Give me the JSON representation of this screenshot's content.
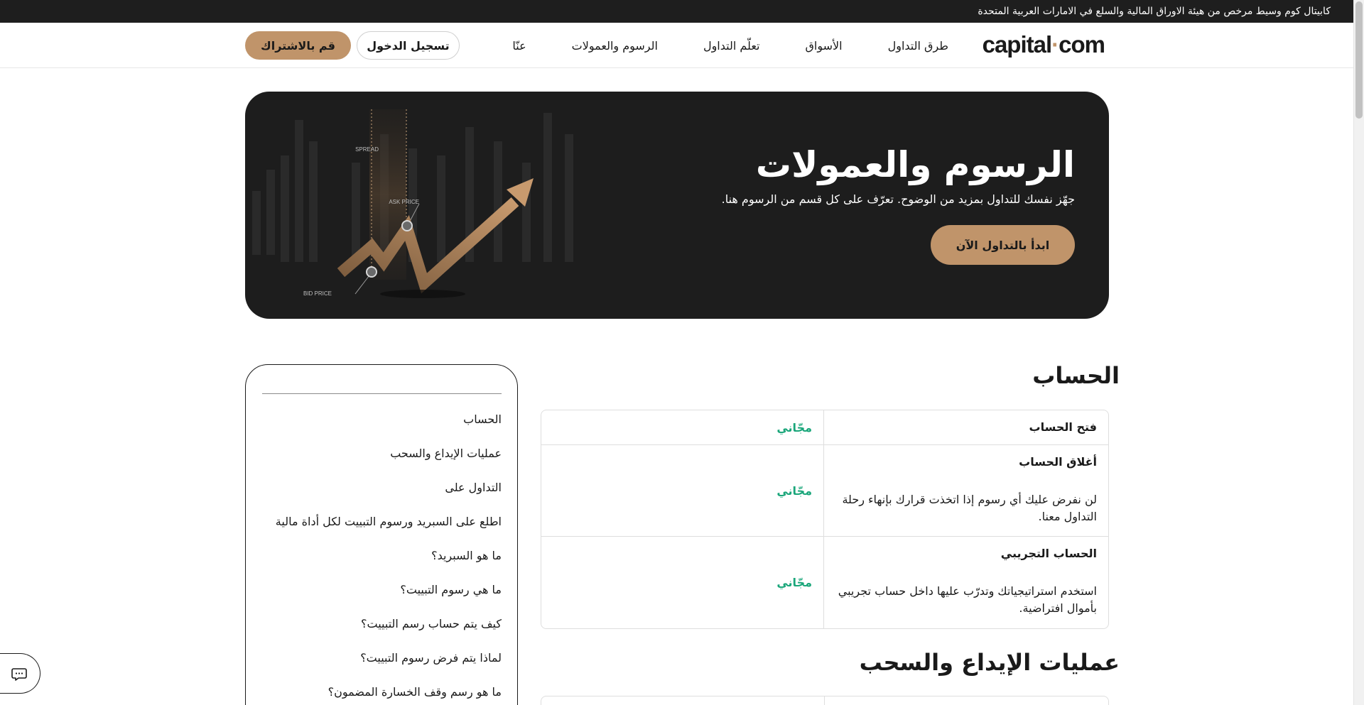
{
  "topbar": {
    "text": "كابيتال كوم وسيط مرخص من هيئة الاوراق المالية والسلع في الامارات العربية المتحدة"
  },
  "header": {
    "logo": {
      "left": "capital",
      "dot": "·",
      "right": "com"
    },
    "nav": [
      "طرق التداول",
      "الأسواق",
      "تعلّم التداول",
      "الرسوم والعمولات",
      "عنّا"
    ],
    "login_label": "تسجيل الدخول",
    "signup_label": "قم بالاشتراك"
  },
  "hero": {
    "title": "الرسوم والعمولات",
    "subtitle": "جهّز نفسك للتداول بمزيد من الوضوح. تعرّف على كل قسم من الرسوم هنا.",
    "cta_label": "ابدأ بالتداول الآن",
    "art_labels": {
      "spread": "SPREAD",
      "ask": "ASK PRICE",
      "bid": "BID PRICE"
    }
  },
  "toc": {
    "items": [
      "الحساب",
      "عمليات الإيداع والسحب",
      "التداول على",
      "اطلع على السبريد ورسوم التبييت لكل أداة مالية",
      "ما هو السبريد؟",
      "ما هي رسوم التبييت؟",
      "كيف يتم حساب رسم التبييت؟",
      "لماذا يتم فرض رسوم التبييت؟",
      "ما هو رسم وقف الخسارة المضمون؟"
    ]
  },
  "account": {
    "title": "الحساب",
    "rows": [
      {
        "name": "فتح الحساب",
        "desc": "",
        "value": "مجّاني"
      },
      {
        "name": "أغلاق الحساب",
        "desc": "لن نفرض عليك أي رسوم إذا اتخذت قرارك بإنهاء رحلة التداول معنا.",
        "value": "مجّاني"
      },
      {
        "name": "الحساب التجريبي",
        "desc": "استخدم استراتيجياتك وتدرّب عليها داخل حساب تجريبي بأموال افتراضية.",
        "value": "مجّاني"
      }
    ]
  },
  "deposits": {
    "title": "عمليات الإيداع والسحب"
  },
  "colors": {
    "brand": "#c0946a",
    "free": "#1aa67a",
    "dark": "#1d1d1d"
  },
  "icons": {
    "chat": "chat-bubble-icon"
  }
}
